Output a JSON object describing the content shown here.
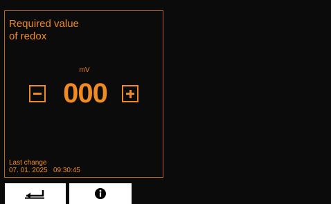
{
  "panel": {
    "title_line1": "Required value",
    "title_line2": "of redox",
    "unit": "mV",
    "value": "000",
    "last_change_label": "Last change",
    "last_change_value": "07. 01. 2025   09:30:45"
  },
  "icons": {
    "decrement": "minus-icon",
    "increment": "plus-icon",
    "back": "return-arrow-icon",
    "info": "info-icon"
  },
  "colors": {
    "background": "#0b0b0b",
    "accent": "#f08a22",
    "panel_border": "#b86a1f",
    "button_bg": "#ffffff",
    "icon": "#000000"
  }
}
